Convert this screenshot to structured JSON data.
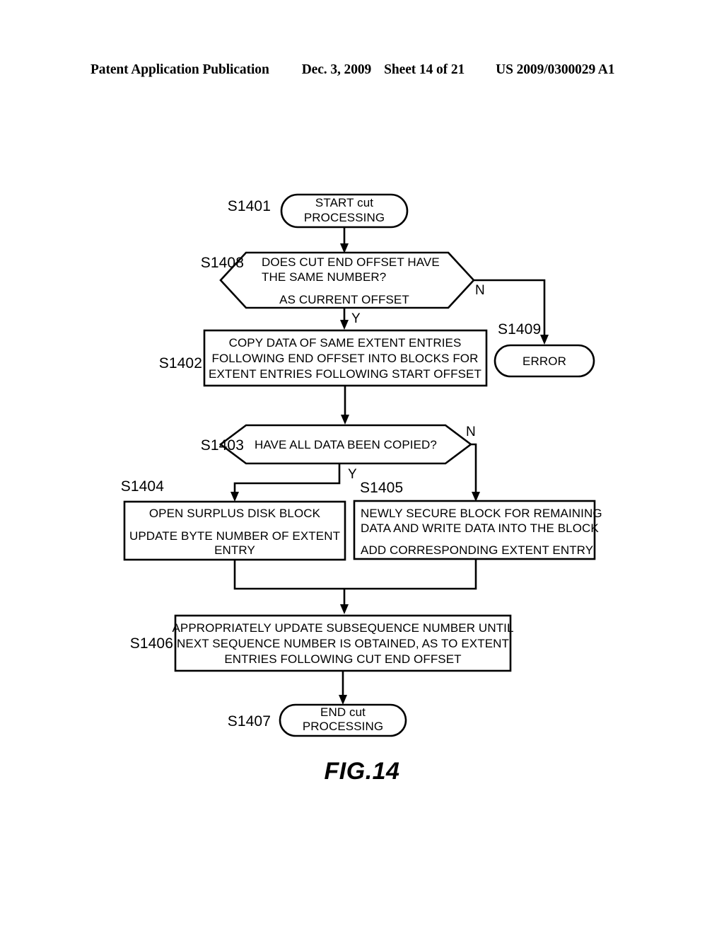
{
  "header": {
    "publication": "Patent Application Publication",
    "date": "Dec. 3, 2009",
    "sheet": "Sheet 14 of 21",
    "patent_number": "US 2009/0300029 A1"
  },
  "figure": {
    "caption": "FIG.14"
  },
  "flowchart": {
    "type": "flowchart",
    "nodes": [
      {
        "id": "S1401",
        "shape": "terminator",
        "lines": [
          "START cut",
          "PROCESSING"
        ]
      },
      {
        "id": "S1408",
        "shape": "decision-hexagon",
        "lines": [
          "DOES CUT END OFFSET HAVE",
          "THE SAME NUMBER?",
          "AS CURRENT OFFSET"
        ]
      },
      {
        "id": "S1402",
        "shape": "process",
        "lines": [
          "COPY DATA OF SAME EXTENT ENTRIES",
          "FOLLOWING END OFFSET INTO BLOCKS FOR",
          "EXTENT ENTRIES FOLLOWING START OFFSET"
        ]
      },
      {
        "id": "S1409",
        "shape": "terminator",
        "lines": [
          "ERROR"
        ]
      },
      {
        "id": "S1403",
        "shape": "decision-hexagon",
        "lines": [
          "HAVE ALL DATA BEEN COPIED?"
        ]
      },
      {
        "id": "S1404",
        "shape": "process",
        "lines": [
          "OPEN SURPLUS DISK BLOCK",
          "UPDATE BYTE NUMBER OF EXTENT",
          "ENTRY"
        ]
      },
      {
        "id": "S1405",
        "shape": "process",
        "lines": [
          "NEWLY SECURE BLOCK FOR REMAINING",
          "DATA AND WRITE DATA INTO THE BLOCK",
          "ADD CORRESPONDING EXTENT ENTRY"
        ]
      },
      {
        "id": "S1406",
        "shape": "process",
        "lines": [
          "APPROPRIATELY UPDATE SUBSEQUENCE NUMBER UNTIL",
          "NEXT SEQUENCE NUMBER IS OBTAINED, AS TO EXTENT",
          "ENTRIES FOLLOWING CUT END OFFSET"
        ]
      },
      {
        "id": "S1407",
        "shape": "terminator",
        "lines": [
          "END cut",
          "PROCESSING"
        ]
      }
    ],
    "edge_labels": {
      "s1408_yes": "Y",
      "s1408_no": "N",
      "s1403_yes": "Y",
      "s1403_no": "N"
    },
    "text": {
      "s1401_l1": "START cut",
      "s1401_l2": "PROCESSING",
      "s1408_l1": "DOES CUT END OFFSET HAVE",
      "s1408_l2": "THE SAME NUMBER?",
      "s1408_l3": "AS CURRENT OFFSET",
      "s1402_l1": "COPY DATA OF SAME EXTENT ENTRIES",
      "s1402_l2": "FOLLOWING END OFFSET INTO BLOCKS FOR",
      "s1402_l3": "EXTENT ENTRIES FOLLOWING START OFFSET",
      "s1409_l1": "ERROR",
      "s1403_l1": "HAVE ALL DATA BEEN COPIED?",
      "s1404_l1": "OPEN SURPLUS DISK BLOCK",
      "s1404_l2": "UPDATE BYTE NUMBER OF EXTENT",
      "s1404_l3": "ENTRY",
      "s1405_l1": "NEWLY SECURE BLOCK FOR REMAINING",
      "s1405_l2": "DATA AND WRITE DATA INTO THE BLOCK",
      "s1405_l3": "ADD CORRESPONDING EXTENT ENTRY",
      "s1406_l1": "APPROPRIATELY UPDATE SUBSEQUENCE NUMBER UNTIL",
      "s1406_l2": "NEXT SEQUENCE NUMBER IS OBTAINED, AS TO EXTENT",
      "s1406_l3": "ENTRIES FOLLOWING CUT END OFFSET",
      "s1407_l1": "END cut",
      "s1407_l2": "PROCESSING"
    },
    "labels": {
      "s1401": "S1401",
      "s1408": "S1408",
      "s1402": "S1402",
      "s1409": "S1409",
      "s1403": "S1403",
      "s1404": "S1404",
      "s1405": "S1405",
      "s1406": "S1406",
      "s1407": "S1407"
    }
  }
}
